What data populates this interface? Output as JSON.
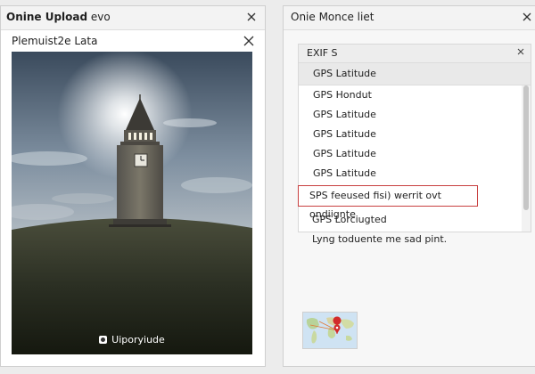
{
  "left_window": {
    "title_bold": "Onine Upload",
    "title_rest": " evo",
    "dialog_title": "Plemuist2e Lata",
    "photo_caption": "Uiporyiude"
  },
  "right_window": {
    "title": "Onie Monce liet",
    "panel_header": "EXIF S",
    "selected_item": "GPS Latitude",
    "list_items": [
      "GPS Hondut",
      "GPS Latitude",
      "GPS Latitude",
      "GPS Latitude",
      "GPS Latitude"
    ],
    "highlighted_item": "SPS feeused fisi) werrit ovt ondiignte",
    "after_items": [
      "GPS Lorciugted",
      "Lyng toduente me sad pint."
    ]
  },
  "colors": {
    "highlight_border": "#c84040",
    "map_pin": "#d22b2b"
  },
  "icons": {
    "close": "close-icon",
    "camera": "camera-icon",
    "map_pin": "map-pin-icon"
  }
}
